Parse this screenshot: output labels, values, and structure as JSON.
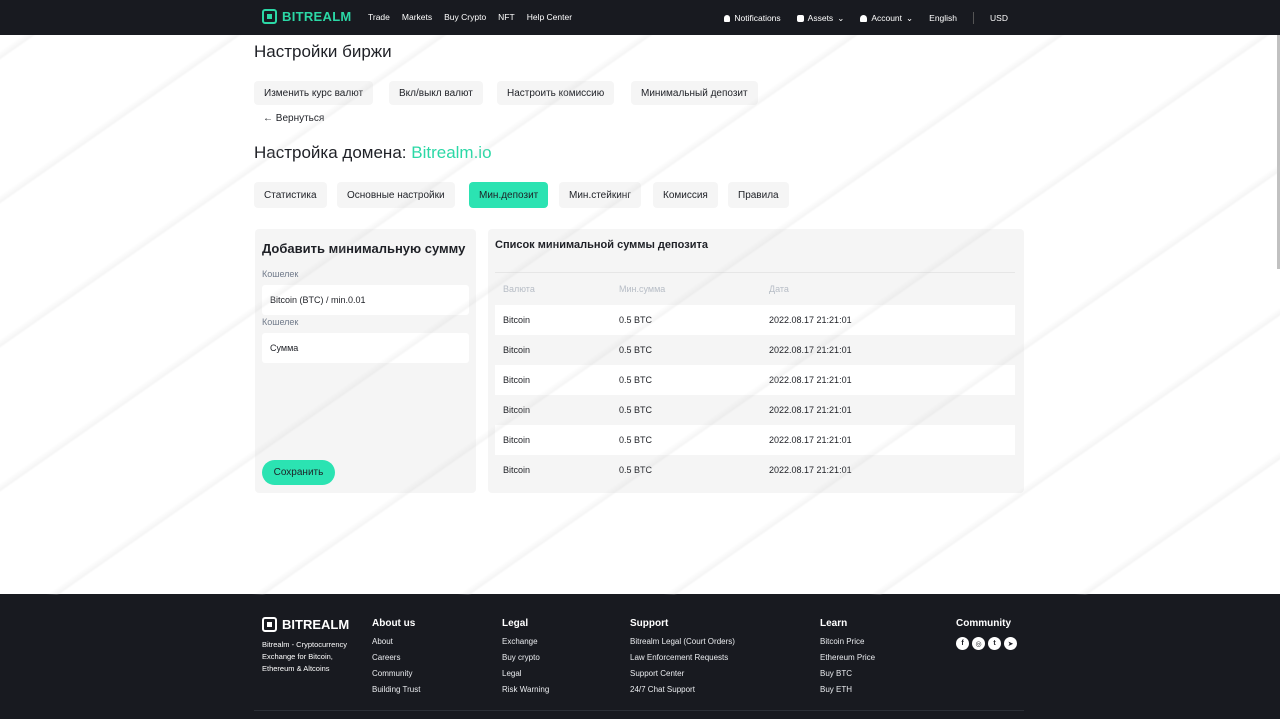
{
  "brand": {
    "name": "BITREALM",
    "accent": "#2bd8a6"
  },
  "topnav": {
    "links": [
      "Trade",
      "Markets",
      "Buy Crypto",
      "NFT",
      "Help Center"
    ],
    "notifications": "Notifications",
    "assets": "Assets",
    "account": "Account",
    "language": "English",
    "currency": "USD"
  },
  "page": {
    "title": "Настройки биржи",
    "actions": [
      "Изменить курс валют",
      "Вкл/выкл валют",
      "Настроить комиссию",
      "Минимальный депозит"
    ],
    "back": "← Вернуться",
    "domain_label": "Настройка домена:",
    "domain_name": "Bitrealm.io",
    "tabs": [
      "Статистика",
      "Основные настройки",
      "Мин.депозит",
      "Мин.стейкинг",
      "Комиссия",
      "Правила"
    ],
    "active_tab": "Мин.депозит"
  },
  "form": {
    "title": "Добавить минимальную сумму",
    "wallet_label": "Кошелек",
    "wallet_value": "Bitcoin (BTC) / min.0.01",
    "amount_label": "Кошелек",
    "amount_placeholder": "Сумма",
    "save": "Сохранить"
  },
  "list": {
    "title": "Список минимальной суммы депозита",
    "columns": [
      "Валюта",
      "Мин.сумма",
      "Дата"
    ],
    "rows": [
      [
        "Bitcoin",
        "0.5 BTC",
        "2022.08.17 21:21:01"
      ],
      [
        "Bitcoin",
        "0.5 BTC",
        "2022.08.17 21:21:01"
      ],
      [
        "Bitcoin",
        "0.5 BTC",
        "2022.08.17 21:21:01"
      ],
      [
        "Bitcoin",
        "0.5 BTC",
        "2022.08.17 21:21:01"
      ],
      [
        "Bitcoin",
        "0.5 BTC",
        "2022.08.17 21:21:01"
      ],
      [
        "Bitcoin",
        "0.5 BTC",
        "2022.08.17 21:21:01"
      ]
    ]
  },
  "footer": {
    "tagline": "Bitrealm - Cryptocurrency Exchange for Bitcoin, Ethereum & Altcoins",
    "about": {
      "title": "About us",
      "links": [
        "About",
        "Careers",
        "Community",
        "Building Trust"
      ]
    },
    "legal": {
      "title": "Legal",
      "links": [
        "Exchange",
        "Buy crypto",
        "Legal",
        "Risk Warning"
      ]
    },
    "support": {
      "title": "Support",
      "links": [
        "Bitrealm Legal (Court Orders)",
        "Law Enforcement Requests",
        "Support Center",
        "24/7 Chat Support"
      ]
    },
    "learn": {
      "title": "Learn",
      "links": [
        "Bitcoin Price",
        "Ethereum Price",
        "Buy BTC",
        "Buy ETH"
      ]
    },
    "community": {
      "title": "Community",
      "icons": [
        "facebook-icon",
        "instagram-icon",
        "twitter-icon",
        "telegram-icon"
      ]
    }
  }
}
